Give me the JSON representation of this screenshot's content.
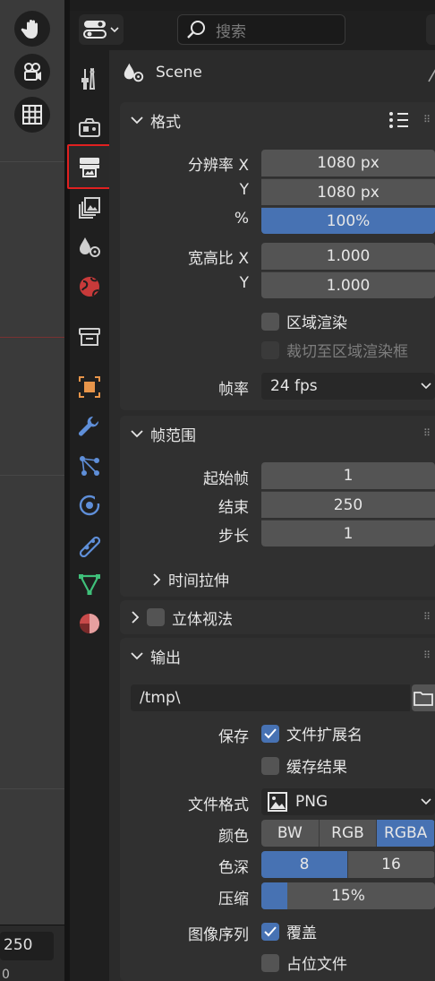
{
  "header": {
    "search_placeholder": "搜索"
  },
  "context": {
    "title": "Scene"
  },
  "viewport": {
    "frame_value": "250",
    "ruler_value": "0"
  },
  "panels": {
    "format": {
      "title": "格式",
      "resolution_x_label": "分辨率 X",
      "resolution_x": "1080 px",
      "resolution_y_label": "Y",
      "resolution_y": "1080 px",
      "percent_label": "%",
      "percent": "100%",
      "aspect_x_label": "宽高比 X",
      "aspect_x": "1.000",
      "aspect_y_label": "Y",
      "aspect_y": "1.000",
      "region_render": "区域渲染",
      "crop_to_region": "裁切至区域渲染框",
      "fps_label": "帧率",
      "fps": "24 fps"
    },
    "frame_range": {
      "title": "帧范围",
      "start_label": "起始帧",
      "start": "1",
      "end_label": "结束",
      "end": "250",
      "step_label": "步长",
      "step": "1",
      "time_stretch": "时间拉伸"
    },
    "stereoscopy": {
      "title": "立体视法"
    },
    "output": {
      "title": "输出",
      "path": "/tmp\\",
      "save_label": "保存",
      "file_extensions": "文件扩展名",
      "cache_result": "缓存结果",
      "file_format_label": "文件格式",
      "file_format": "PNG",
      "color_label": "颜色",
      "color_options": [
        "BW",
        "RGB",
        "RGBA"
      ],
      "color_selected": "RGBA",
      "depth_label": "色深",
      "depth_options": [
        "8",
        "16"
      ],
      "depth_selected": "8",
      "compression_label": "压缩",
      "compression": "15%",
      "compression_fraction": 0.15,
      "image_sequence_label": "图像序列",
      "overwrite": "覆盖",
      "placeholders": "占位文件"
    }
  },
  "colors": {
    "accent": "#4772b3",
    "field": "#545454",
    "panel": "#303030",
    "highlight_box": "#e02020"
  }
}
